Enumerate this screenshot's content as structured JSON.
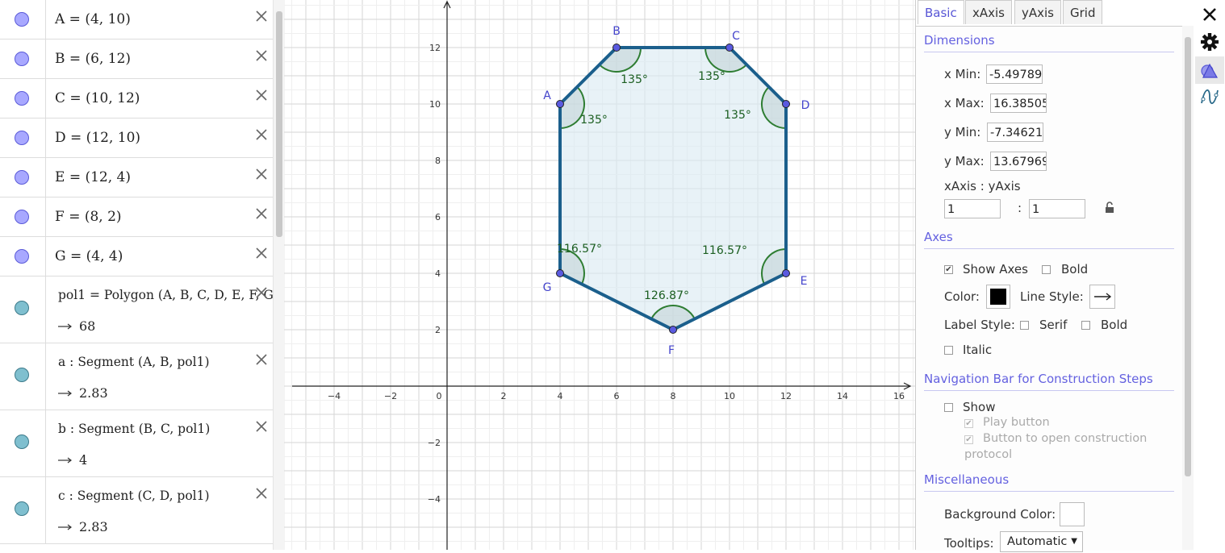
{
  "algebra": {
    "points": [
      {
        "def": "A = (4, 10)"
      },
      {
        "def": "B = (6, 12)"
      },
      {
        "def": "C = (10, 12)"
      },
      {
        "def": "D = (12, 10)"
      },
      {
        "def": "E = (12, 4)"
      },
      {
        "def": "F = (8, 2)"
      },
      {
        "def": "G = (4, 4)"
      }
    ],
    "objects": [
      {
        "def": "pol1 = Polygon (A, B, C, D, E, F, G)",
        "value": "68"
      },
      {
        "def": "a : Segment (A, B, pol1)",
        "value": "2.83"
      },
      {
        "def": "b : Segment (B, C, pol1)",
        "value": "4"
      },
      {
        "def": "c : Segment (C, D, pol1)",
        "value": "2.83"
      }
    ]
  },
  "graphics": {
    "points": [
      {
        "name": "A",
        "x": 4,
        "y": 10
      },
      {
        "name": "B",
        "x": 6,
        "y": 12
      },
      {
        "name": "C",
        "x": 10,
        "y": 12
      },
      {
        "name": "D",
        "x": 12,
        "y": 10
      },
      {
        "name": "E",
        "x": 12,
        "y": 4
      },
      {
        "name": "F",
        "x": 8,
        "y": 2
      },
      {
        "name": "G",
        "x": 4,
        "y": 4
      }
    ],
    "angles": [
      {
        "vertex": "A",
        "label": "135°"
      },
      {
        "vertex": "B",
        "label": "135°"
      },
      {
        "vertex": "C",
        "label": "135°"
      },
      {
        "vertex": "D",
        "label": "135°"
      },
      {
        "vertex": "E",
        "label": "116.57°"
      },
      {
        "vertex": "F",
        "label": "126.87°"
      },
      {
        "vertex": "G",
        "label": "116.57°"
      }
    ],
    "x_ticks": [
      "−4",
      "−2",
      "0",
      "2",
      "4",
      "6",
      "8",
      "10",
      "12",
      "14",
      "16"
    ],
    "y_ticks": [
      "12",
      "10",
      "8",
      "6",
      "4",
      "2",
      "−2",
      "−4"
    ],
    "colors": {
      "polygon_edge": "#1b5f8c",
      "polygon_fill": "#d9eaf2",
      "angle": "#2e7d32",
      "point": "#5a5ae0",
      "label": "#4444cc"
    }
  },
  "settings": {
    "tabs": [
      "Basic",
      "xAxis",
      "yAxis",
      "Grid"
    ],
    "dimensions": {
      "title": "Dimensions",
      "xmin_label": "x Min:",
      "xmin": "-5.49789",
      "xmax_label": "x Max:",
      "xmax": "16.38505",
      "ymin_label": "y Min:",
      "ymin": "-7.34621",
      "ymax_label": "y Max:",
      "ymax": "13.67969",
      "ratio_label": "xAxis : yAxis",
      "ratio_x": "1",
      "ratio_sep": ":",
      "ratio_y": "1"
    },
    "axes": {
      "title": "Axes",
      "show_axes": "Show Axes",
      "bold": "Bold",
      "color_label": "Color:",
      "line_style_label": "Line Style:",
      "label_style": "Label Style:",
      "serif": "Serif",
      "bold2": "Bold",
      "italic": "Italic"
    },
    "navbar": {
      "title": "Navigation Bar for Construction Steps",
      "show": "Show",
      "play": "Play button",
      "button_open": "Button to open construction",
      "protocol": "protocol"
    },
    "misc": {
      "title": "Miscellaneous",
      "bg_label": "Background Color:",
      "tooltips_label": "Tooltips:",
      "tooltips_value": "Automatic"
    }
  }
}
